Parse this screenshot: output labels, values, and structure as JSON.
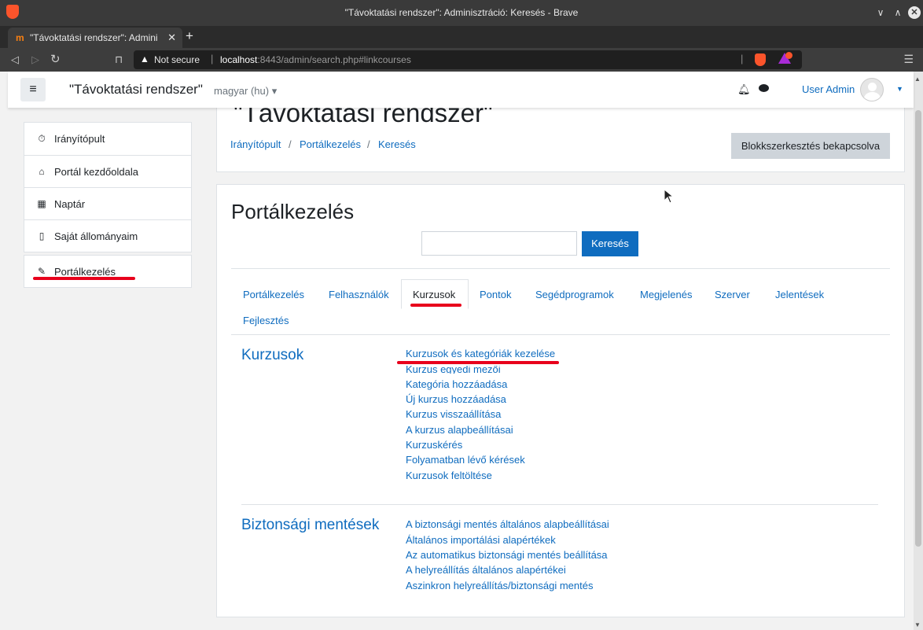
{
  "browser": {
    "window_title": "\"Távoktatási rendszer\": Adminisztráció: Keresés - Brave",
    "tab_title": "\"Távoktatási rendszer\": Admini",
    "tab_favicon": "m",
    "new_tab": "+",
    "not_secure": "Not secure",
    "url_host": "localhost",
    "url_rest": ":8443/admin/search.php#linkcourses",
    "win_minimize": "∨",
    "win_maximize": "∧",
    "win_close": "✕",
    "icons": [
      "brave-logo-icon",
      "back-icon",
      "forward-icon",
      "reload-icon",
      "bookmark-icon",
      "warning-icon",
      "brave-shield-icon",
      "rewards-icon",
      "menu-icon"
    ]
  },
  "navbar": {
    "site_name": "\"Távoktatási rendszer\"",
    "language": "magyar (hu) ▾",
    "user_name": "User Admin",
    "icons": [
      "hamburger-icon",
      "bell-icon",
      "message-icon",
      "avatar-icon",
      "caret-down-icon"
    ]
  },
  "drawer": {
    "group1": [
      {
        "icon": "⏱",
        "label": "Irányítópult"
      },
      {
        "icon": "⌂",
        "label": "Portál kezdőoldala"
      },
      {
        "icon": "▦",
        "label": "Naptár"
      },
      {
        "icon": "▯",
        "label": "Saját állományaim"
      }
    ],
    "group2": [
      {
        "icon": "✎",
        "label": "Portálkezelés"
      }
    ]
  },
  "header": {
    "title": "\"Távoktatási rendszer\"",
    "breadcrumb": [
      "Irányítópult",
      "Portálkezelés",
      "Keresés"
    ],
    "breadcrumb_sep": "/",
    "edit_button": "Blokkszerkesztés bekapcsolva"
  },
  "main": {
    "heading": "Portálkezelés",
    "search_value": "",
    "search_button": "Keresés",
    "tabs": [
      "Portálkezelés",
      "Felhasználók",
      "Kurzusok",
      "Pontok",
      "Segédprogramok",
      "Megjelenés",
      "Szerver",
      "Jelentések",
      "Fejlesztés"
    ],
    "active_tab": "Kurzusok",
    "sections": [
      {
        "title": "Kurzusok",
        "links": [
          "Kurzusok és kategóriák kezelése",
          "Kurzus egyedi mezői",
          "Kategória hozzáadása",
          "Új kurzus hozzáadása",
          "Kurzus visszaállítása",
          "A kurzus alapbeállításai",
          "Kurzuskérés",
          "Folyamatban lévő kérések",
          "Kurzusok feltöltése"
        ]
      },
      {
        "title": "Biztonsági mentések",
        "links": [
          "A biztonsági mentés általános alapbeállításai",
          "Általános importálási alapértékek",
          "Az automatikus biztonsági mentés beállítása",
          "A helyreállítás általános alapértékei",
          "Aszinkron helyreállítás/biztonsági mentés"
        ]
      }
    ]
  },
  "colors": {
    "link": "#0f6cbf",
    "annotation": "#e8001c",
    "button_primary": "#0f6cbf",
    "button_secondary": "#ced4da"
  }
}
